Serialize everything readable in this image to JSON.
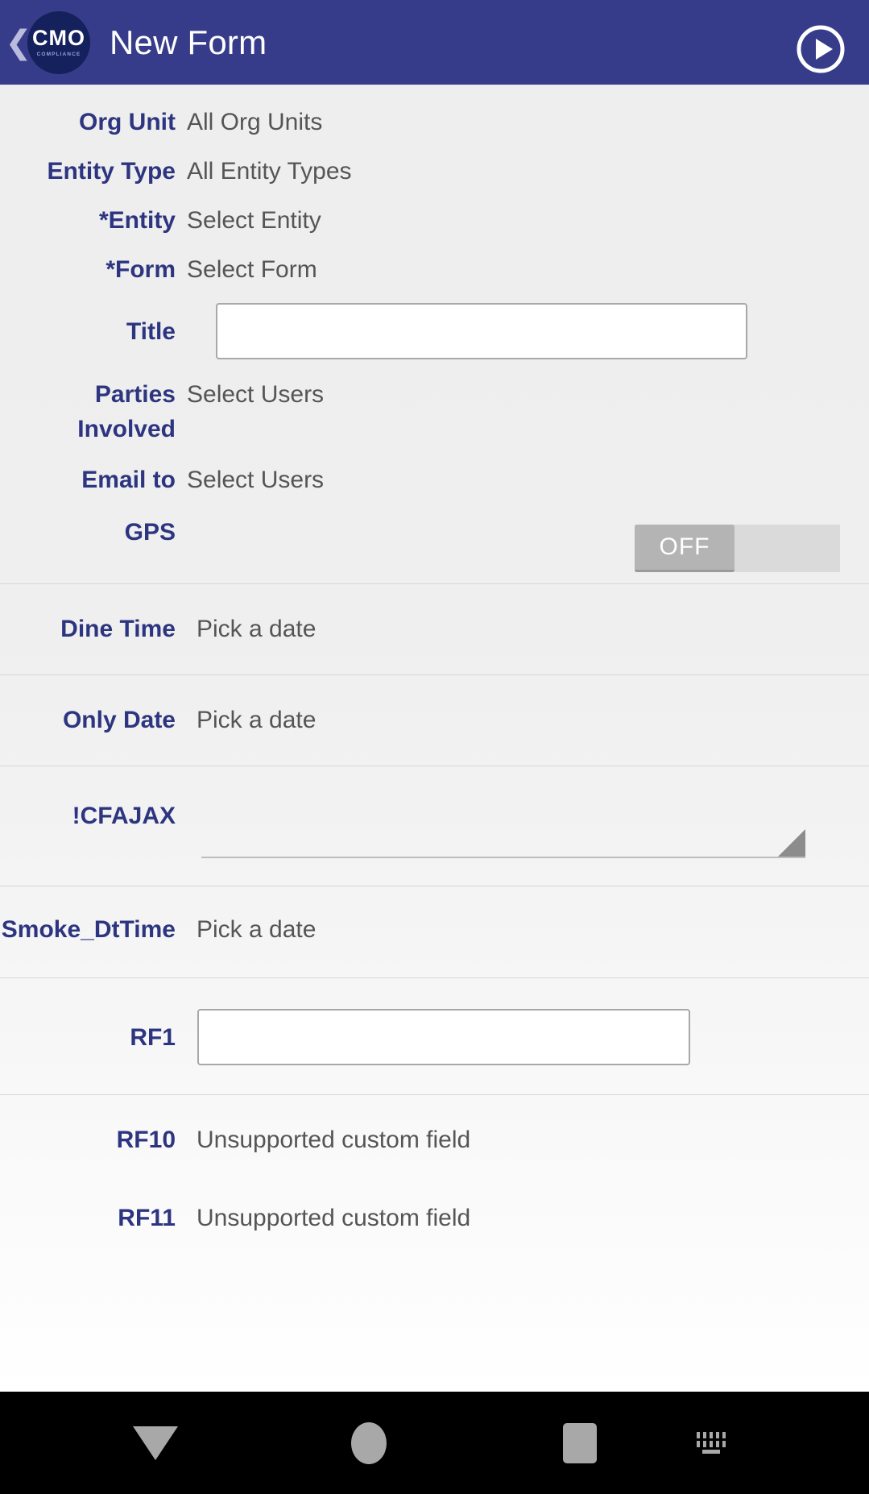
{
  "appbar": {
    "back_icon": "back-chevron-icon",
    "logo_main": "CMO",
    "logo_sub": "COMPLIANCE",
    "title": "New Form",
    "submit_icon": "play-circle-icon",
    "bg_color": "#373c8a"
  },
  "theme": {
    "label_color": "#2d3580",
    "value_color": "#555555",
    "accent": "#373c8a"
  },
  "form": {
    "rows": [
      {
        "label": "Org Unit",
        "value": "All Org Units",
        "control": "text"
      },
      {
        "label": "Entity Type",
        "value": "All Entity Types",
        "control": "text"
      },
      {
        "label": "*Entity",
        "value": "Select Entity",
        "control": "text"
      },
      {
        "label": "*Form",
        "value": "Select Form",
        "control": "text"
      },
      {
        "label": "Title",
        "value": "",
        "control": "input"
      },
      {
        "label": "Parties Involved",
        "value": "Select Users",
        "control": "text"
      },
      {
        "label": "Email to",
        "value": "Select Users",
        "control": "text"
      },
      {
        "label": "GPS",
        "value": "OFF",
        "control": "toggle"
      },
      {
        "label": "Dine Time",
        "value": "Pick a date",
        "control": "text"
      },
      {
        "label": "Only Date",
        "value": "Pick a date",
        "control": "text"
      },
      {
        "label": "!CFAJAX",
        "value": "",
        "control": "spinner"
      },
      {
        "label": "Smoke_DtTime",
        "value": "Pick a date",
        "control": "text"
      },
      {
        "label": "RF1",
        "value": "",
        "control": "input"
      },
      {
        "label": "RF10",
        "value": "Unsupported custom field",
        "control": "text"
      },
      {
        "label": "RF11",
        "value": "Unsupported custom field",
        "control": "text"
      }
    ]
  },
  "navbar": {
    "back_icon": "nav-back-triangle-icon",
    "home_icon": "nav-home-circle-icon",
    "recents_icon": "nav-recents-square-icon",
    "keyboard_icon": "nav-keyboard-icon"
  }
}
